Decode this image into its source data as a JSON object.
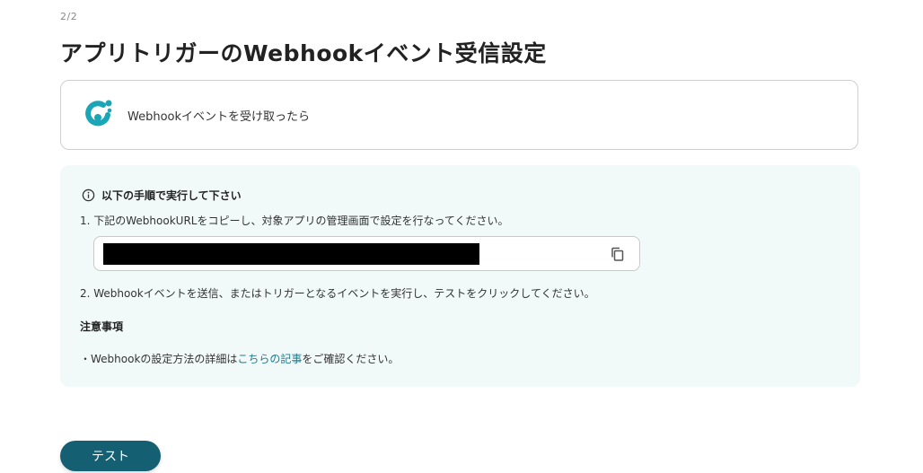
{
  "header": {
    "step_indicator": "2/2",
    "title": "アプリトリガーのWebhookイベント受信設定"
  },
  "trigger_card": {
    "label": "Webhookイベントを受け取ったら",
    "logo_icon": "app-logo-icon",
    "logo_color": "#1aa6b7"
  },
  "instructions": {
    "heading": "以下の手順で実行して下さい",
    "step1": "1. 下記のWebhookURLをコピーし、対象アプリの管理画面で設定を行なってください。",
    "step2": "2. Webhookイベントを送信、またはトリガーとなるイベントを実行し、テストをクリックしてください。",
    "copy_icon": "copy-icon"
  },
  "notes": {
    "heading": "注意事項",
    "line_prefix": "・Webhookの設定方法の詳細は",
    "link_text": "こちらの記事",
    "line_suffix": "をご確認ください。"
  },
  "actions": {
    "test_label": "テスト",
    "test_color": "#155f73"
  },
  "colors": {
    "panel_bg": "#f1f9f9",
    "link": "#1f7a8c"
  }
}
